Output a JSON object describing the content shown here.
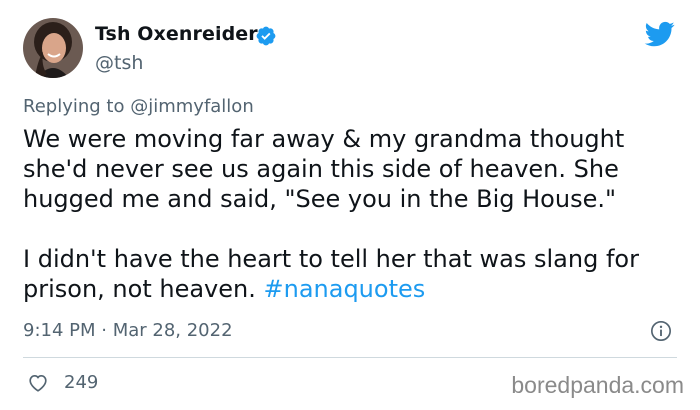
{
  "author": {
    "display_name": "Tsh Oxenreider",
    "handle": "@tsh",
    "verified": true
  },
  "reply": {
    "prefix": "Replying to",
    "mention": "@jimmyfallon"
  },
  "tweet": {
    "paragraph1": "We were moving far away & my grandma thought she'd never see us again this side of heaven. She hugged me and said, \"See you in the Big House.\"",
    "paragraph2_text": "I didn't have the heart to tell her that was slang for prison, not heaven.",
    "hashtag": "#nanaquotes"
  },
  "meta": {
    "timestamp": "9:14 PM · Mar 28, 2022",
    "like_count": "249"
  },
  "watermark": "boredpanda.com",
  "icons": {
    "brand": "twitter-bird-icon",
    "verified": "verified-badge-icon",
    "info": "info-icon",
    "like": "heart-icon"
  },
  "colors": {
    "accent": "#1d9bf0",
    "text": "#0f1419",
    "secondary": "#536471",
    "divider": "#cfd9de"
  }
}
